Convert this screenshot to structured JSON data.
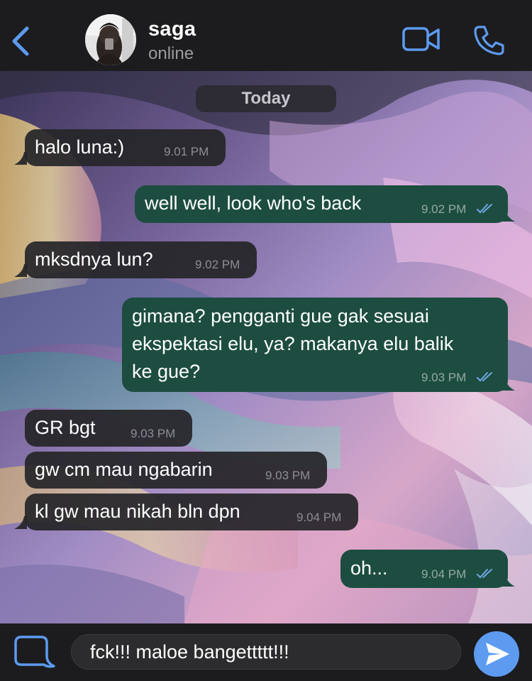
{
  "header": {
    "contact_name": "saga",
    "status": "online",
    "icons": [
      "back-icon",
      "avatar",
      "video-call-icon",
      "phone-icon"
    ]
  },
  "date_label": "Today",
  "messages": [
    {
      "direction": "incoming",
      "text": "halo luna:)",
      "time": "9.01 PM"
    },
    {
      "direction": "outgoing",
      "text": "well well, look who's back",
      "time": "9.02 PM",
      "read": true
    },
    {
      "direction": "incoming",
      "text": "mksdnya lun?",
      "time": "9.02 PM"
    },
    {
      "direction": "outgoing",
      "lines": [
        "gimana? pengganti gue gak sesuai",
        "ekspektasi elu, ya? makanya elu balik",
        "ke gue?"
      ],
      "time": "9.03 PM",
      "read": true
    },
    {
      "direction": "incoming",
      "text": "GR bgt",
      "time": "9.03 PM"
    },
    {
      "direction": "incoming",
      "text": "gw cm mau ngabarin",
      "time": "9.03 PM"
    },
    {
      "direction": "incoming",
      "text": "kl gw mau nikah bln dpn",
      "time": "9.04 PM"
    },
    {
      "direction": "outgoing",
      "text": "oh...",
      "time": "9.04 PM",
      "read": true
    }
  ],
  "composer": {
    "value": "fck!!! maloe bangettttt!!!",
    "icons": [
      "sticker-icon",
      "send-icon"
    ]
  },
  "colors": {
    "accent": "#5d9bf0",
    "outgoing_bubble": "#1d4d40",
    "incoming_bubble": "#262629",
    "bar_background": "#1c1c1e",
    "read_ticks": "#6fa6e6"
  }
}
